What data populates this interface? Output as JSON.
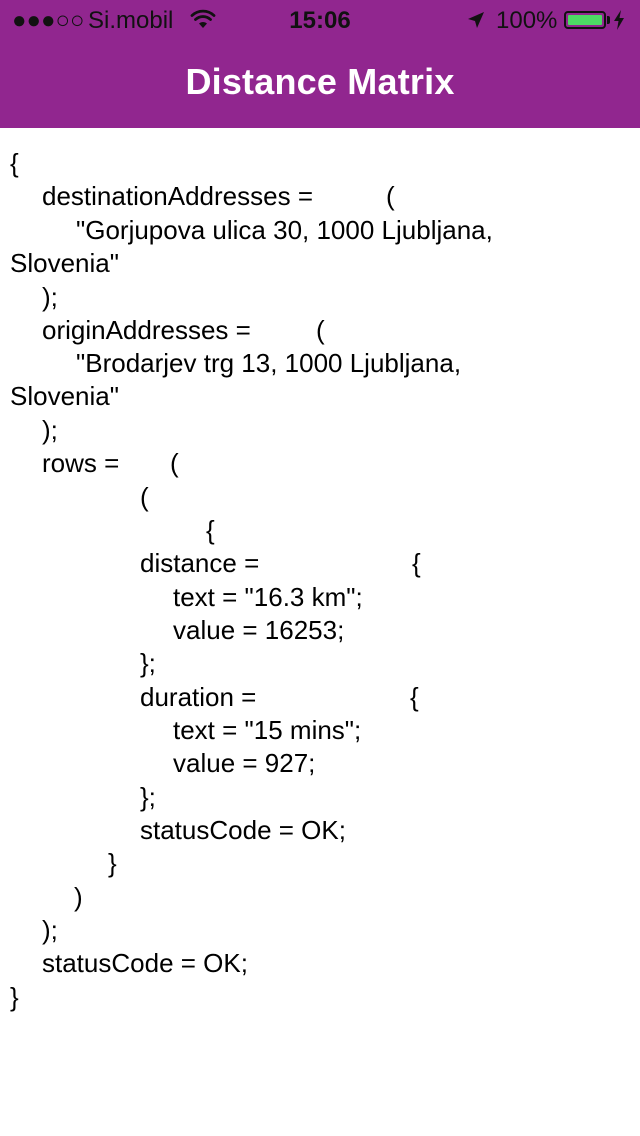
{
  "status_bar": {
    "signal": "●●●○○",
    "carrier": "Si.mobil",
    "time": "15:06",
    "battery_percent": "100%",
    "battery_level": 1.0,
    "icons": [
      "wifi-icon",
      "location-arrow-icon",
      "battery-icon",
      "charging-bolt-icon"
    ]
  },
  "nav": {
    "title": "Distance Matrix"
  },
  "colors": {
    "nav_background": "#91268f",
    "nav_text": "#ffffff",
    "battery_fill": "#4cd964",
    "body_text": "#000000"
  },
  "content": {
    "lines": [
      "{",
      "destinationAddresses =",
      "(",
      "\"Gorjupova ulica 30, 1000 Ljubljana,",
      "Slovenia\"",
      ");",
      "originAddresses =",
      "(",
      "\"Brodarjev trg 13, 1000 Ljubljana,",
      "Slovenia\"",
      ");",
      "rows =",
      "(",
      "(",
      "{",
      "distance =",
      "{",
      "text = \"16.3 km\";",
      "value = 16253;",
      "};",
      "duration =",
      "{",
      "text = \"15 mins\";",
      "value = 927;",
      "};",
      "statusCode = OK;",
      "}",
      ")",
      ");",
      "statusCode = OK;",
      "}"
    ]
  }
}
